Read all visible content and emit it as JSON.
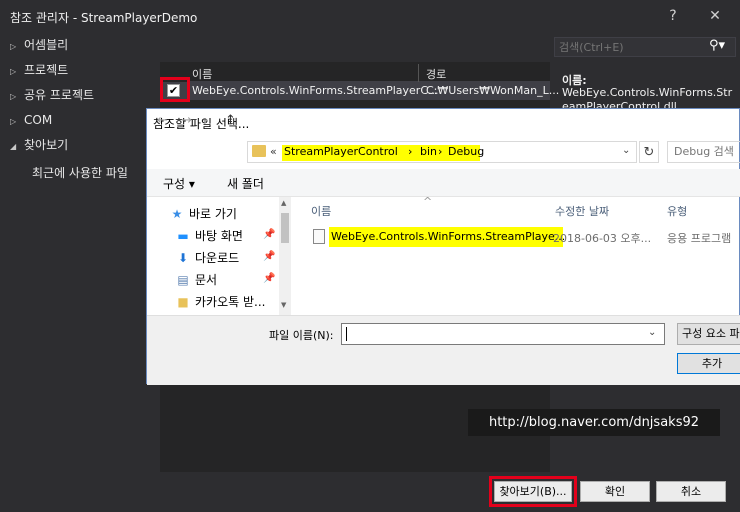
{
  "window": {
    "title": "참조 관리자 - StreamPlayerDemo",
    "help": "?",
    "close": "✕"
  },
  "sidebar": {
    "items": [
      {
        "label": "어셈블리",
        "arrow": "▷"
      },
      {
        "label": "프로젝트",
        "arrow": "▷"
      },
      {
        "label": "공유 프로젝트",
        "arrow": "▷"
      },
      {
        "label": "COM",
        "arrow": "▷"
      },
      {
        "label": "찾아보기",
        "arrow": "◢"
      }
    ],
    "sub_item": "최근에 사용한 파일"
  },
  "references": {
    "columns": [
      "이름",
      "경로"
    ],
    "rows": [
      {
        "checked": true,
        "name": "WebEye.Controls.WinForms.StreamPlayerC...",
        "path": "C:₩Users₩WonMan_L..."
      }
    ]
  },
  "search": {
    "placeholder": "검색(Ctrl+E)"
  },
  "details": {
    "name_label": "이름:",
    "name_value": "WebEye.Controls.WinForms.StreamPlayerControl.dll"
  },
  "buttons": {
    "browse": "찾아보기(B)...",
    "ok": "확인",
    "cancel": "취소"
  },
  "file_dialog": {
    "title": "참조할 파일 선택...",
    "address": {
      "prefix": "«",
      "segments": [
        "StreamPlayerControl",
        "bin",
        "Debug"
      ]
    },
    "search_placeholder": "Debug 검색",
    "commands": {
      "organize": "구성 ▾",
      "new_folder": "새 폴더"
    },
    "nav": {
      "quick_access": "바로 가기",
      "items": [
        "바탕 화면",
        "다운로드",
        "문서",
        "카카오톡 받..."
      ]
    },
    "columns": [
      "이름",
      "수정한 날짜",
      "유형"
    ],
    "files": [
      {
        "name": "WebEye.Controls.WinForms.StreamPlaye...",
        "date": "2018-06-03 오후...",
        "type": "응용 프로그램"
      }
    ],
    "filename_label": "파일 이름(N):",
    "filter": "구성 요소 파",
    "add": "추가"
  },
  "watermark": "http://blog.naver.com/dnjsaks92",
  "colors": {
    "dark_bg": "#2d2d30",
    "highlight_red": "#e3001b",
    "highlight_yellow": "#ffff00"
  }
}
